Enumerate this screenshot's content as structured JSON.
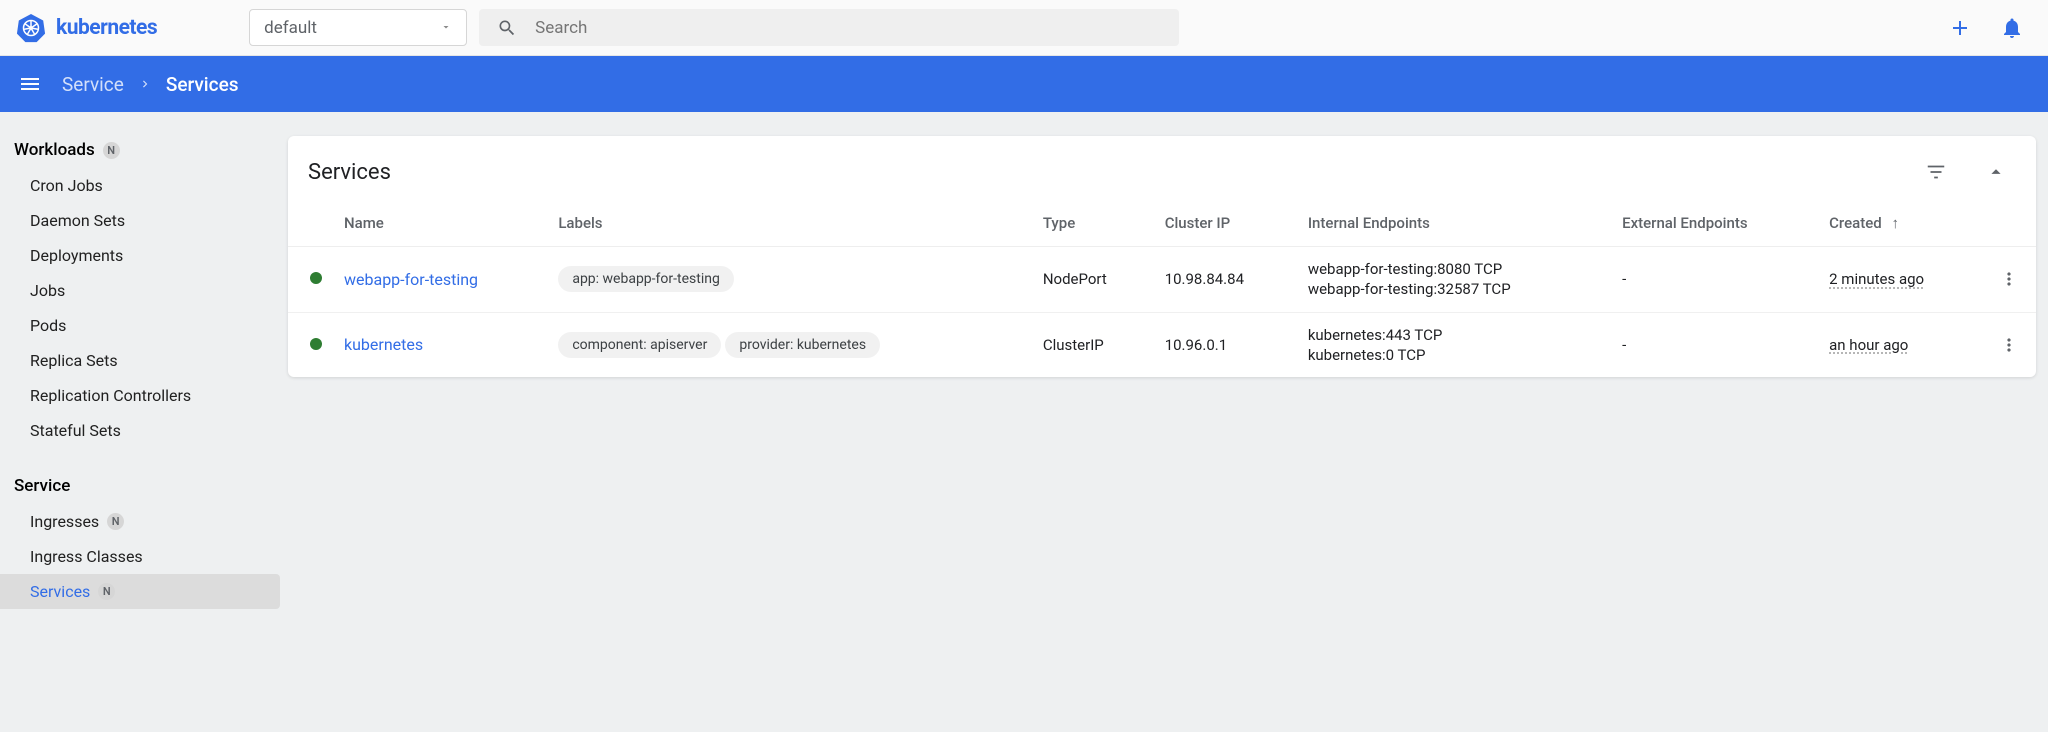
{
  "app": {
    "name": "kubernetes"
  },
  "namespace": {
    "selected": "default"
  },
  "search": {
    "placeholder": "Search"
  },
  "breadcrumb": {
    "parent": "Service",
    "current": "Services"
  },
  "sidebar": {
    "sections": [
      {
        "title": "Workloads",
        "badge": "N",
        "items": [
          {
            "label": "Cron Jobs"
          },
          {
            "label": "Daemon Sets"
          },
          {
            "label": "Deployments"
          },
          {
            "label": "Jobs"
          },
          {
            "label": "Pods"
          },
          {
            "label": "Replica Sets"
          },
          {
            "label": "Replication Controllers"
          },
          {
            "label": "Stateful Sets"
          }
        ]
      },
      {
        "title": "Service",
        "items": [
          {
            "label": "Ingresses",
            "badge": "N"
          },
          {
            "label": "Ingress Classes"
          },
          {
            "label": "Services",
            "badge": "N",
            "active": true
          }
        ]
      }
    ]
  },
  "card": {
    "title": "Services"
  },
  "table": {
    "columns": {
      "name": "Name",
      "labels": "Labels",
      "type": "Type",
      "cluster_ip": "Cluster IP",
      "internal_endpoints": "Internal Endpoints",
      "external_endpoints": "External Endpoints",
      "created": "Created"
    },
    "rows": [
      {
        "name": "webapp-for-testing",
        "labels": [
          "app: webapp-for-testing"
        ],
        "type": "NodePort",
        "cluster_ip": "10.98.84.84",
        "internal_endpoints": [
          "webapp-for-testing:8080 TCP",
          "webapp-for-testing:32587 TCP"
        ],
        "external_endpoints": "-",
        "created": "2 minutes ago"
      },
      {
        "name": "kubernetes",
        "labels": [
          "component: apiserver",
          "provider: kubernetes"
        ],
        "type": "ClusterIP",
        "cluster_ip": "10.96.0.1",
        "internal_endpoints": [
          "kubernetes:443 TCP",
          "kubernetes:0 TCP"
        ],
        "external_endpoints": "-",
        "created": "an hour ago"
      }
    ]
  }
}
